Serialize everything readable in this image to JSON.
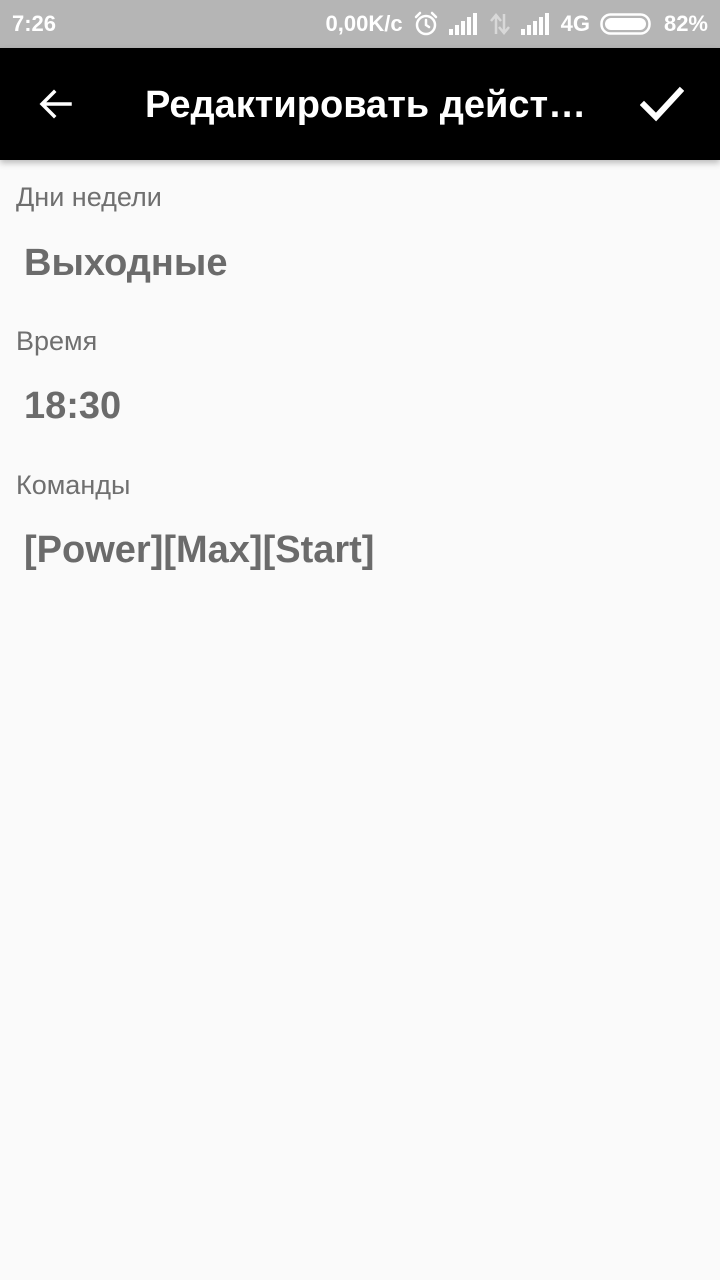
{
  "status_bar": {
    "time": "7:26",
    "net_speed": "0,00K/c",
    "network_type": "4G",
    "battery": "82%",
    "icons": [
      "alarm-icon",
      "signal-icon",
      "data-arrows-icon",
      "signal-icon",
      "battery-icon"
    ]
  },
  "app_bar": {
    "title": "Редактировать действие",
    "back_icon": "arrow-back-icon",
    "confirm_icon": "check-icon"
  },
  "fields": [
    {
      "label": "Дни недели",
      "value": "Выходные"
    },
    {
      "label": "Время",
      "value": "18:30"
    },
    {
      "label": "Команды",
      "value": "[Power][Max][Start]"
    }
  ],
  "colors": {
    "app_bar": "#000000",
    "status_bar": "#b5b5b5",
    "background": "#fafafa",
    "label": "#6f6f6f",
    "value": "#6b6b6b"
  }
}
